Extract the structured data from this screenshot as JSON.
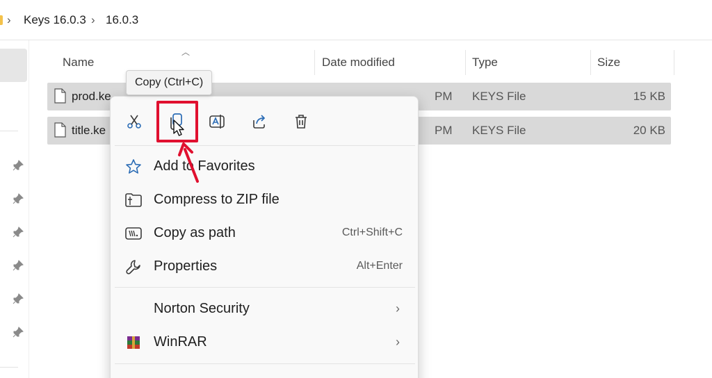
{
  "breadcrumb": {
    "items": [
      "Keys 16.0.3",
      "16.0.3"
    ],
    "separator": "›"
  },
  "columns": {
    "name": "Name",
    "date": "Date modified",
    "type": "Type",
    "size": "Size"
  },
  "files": [
    {
      "name": "prod.ke",
      "date": "PM",
      "type": "KEYS File",
      "size": "15 KB"
    },
    {
      "name": "title.ke",
      "date": "PM",
      "type": "KEYS File",
      "size": "20 KB"
    }
  ],
  "tooltip": {
    "text": "Copy (Ctrl+C)"
  },
  "context_menu": {
    "toolbar": [
      "scissors-icon",
      "copy-icon",
      "rename-icon",
      "share-icon",
      "delete-icon"
    ],
    "items": [
      {
        "label": "Add to Favorites",
        "shortcut": "",
        "icon": "star-icon"
      },
      {
        "label": "Compress to ZIP file",
        "shortcut": "",
        "icon": "zip-icon"
      },
      {
        "label": "Copy as path",
        "shortcut": "Ctrl+Shift+C",
        "icon": "path-icon"
      },
      {
        "label": "Properties",
        "shortcut": "Alt+Enter",
        "icon": "wrench-icon"
      },
      {
        "label": "Norton Security",
        "shortcut": "",
        "icon": ""
      },
      {
        "label": "WinRAR",
        "shortcut": "",
        "icon": "winrar-icon"
      }
    ]
  },
  "colors": {
    "accent_icon": "#2b6cb5",
    "highlight": "#e0102f",
    "selection": "#d9d9d9"
  }
}
